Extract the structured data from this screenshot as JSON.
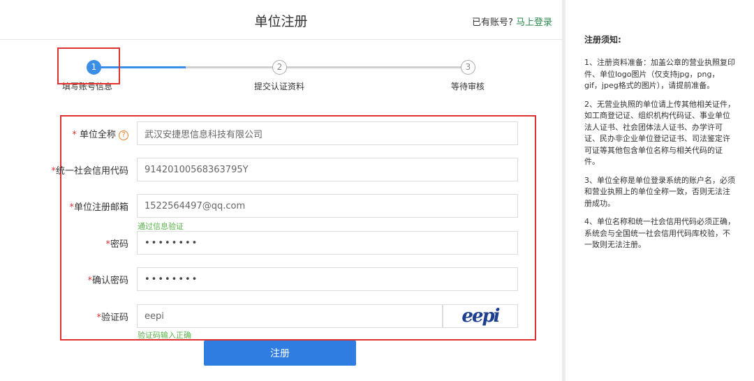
{
  "header": {
    "title": "单位注册",
    "login_prompt": "已有账号?",
    "login_link": "马上登录"
  },
  "steps": [
    {
      "number": "1",
      "label": "填写账号信息",
      "active": true
    },
    {
      "number": "2",
      "label": "提交认证资料",
      "active": false
    },
    {
      "number": "3",
      "label": "等待审核",
      "active": false
    }
  ],
  "form": {
    "company_name": {
      "required_mark": "*",
      "label": "单位全称",
      "help": "?",
      "value": "武汉安捷思信息科技有限公司"
    },
    "credit_code": {
      "required_mark": "*",
      "label": "统一社会信用代码",
      "value": "91420100568363795Y"
    },
    "email": {
      "required_mark": "*",
      "label": "单位注册邮箱",
      "value": "1522564497@qq.com",
      "validation": "通过信息验证"
    },
    "password": {
      "required_mark": "*",
      "label": "密码",
      "value": "••••••••"
    },
    "confirm_password": {
      "required_mark": "*",
      "label": "确认密码",
      "value": "••••••••"
    },
    "captcha": {
      "required_mark": "*",
      "label": "验证码",
      "value": "eepi",
      "image_text": "eepi",
      "validation": "验证码输入正确"
    },
    "submit_label": "注册"
  },
  "notice": {
    "title": "注册须知:",
    "items": [
      "1、注册资料准备：加盖公章的营业执照复印件、单位logo图片（仅支持jpg，png，gif，jpeg格式的图片），请提前准备。",
      "2、无营业执照的单位请上传其他相关证件，如工商登记证、组织机构代码证、事业单位法人证书、社会团体法人证书、办学许可证、民办非企业单位登记证书、司法鉴定许可证等其他包含单位名称与相关代码的证件。",
      "3、单位全称是单位登录系统的账户名，必须和营业执照上的单位全称一致，否则无法注册成功。",
      "4、单位名称和统一社会信用代码必须正确，系统会与全国统一社会信用代码库校验，不一致则无法注册。"
    ]
  },
  "colors": {
    "primary": "#2f7de1",
    "step_active": "#3a8ee6",
    "success": "#58b449",
    "highlight": "#e03030",
    "login_link": "#2a8a4a"
  }
}
